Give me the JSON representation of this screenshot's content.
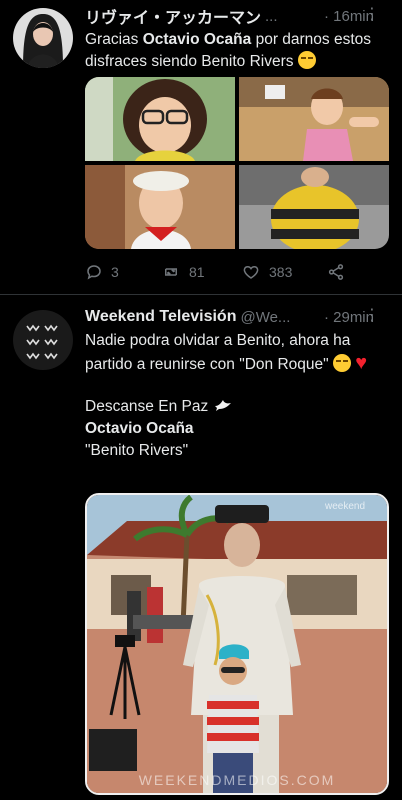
{
  "tweets": [
    {
      "author": "リヴァイ・アッカーマン",
      "handle": "...",
      "time": "· 16min",
      "text_pre": "Gracias ",
      "text_bold": "Octavio Ocaña",
      "text_post": " por darnos estos disfraces siendo Benito Rivers",
      "replies": "3",
      "retweets": "81",
      "likes": "383"
    },
    {
      "author": "Weekend Televisión",
      "handle": "@We...",
      "time": "· 29min",
      "line1": "Nadie podra olvidar a Benito, ahora ha partido a reunirse con \"Don Roque\"",
      "line2": "Descanse En Paz",
      "line3": "Octavio Ocaña",
      "line4": "\"Benito Rivers\"",
      "watermark": "WEEKENDMEDIOS.COM",
      "photo_logo": "weekend"
    }
  ],
  "colors": {
    "background": "#000000",
    "text": "#e7e9ea",
    "muted": "#71767b",
    "divider": "#2f3336",
    "heart": "#f4212e"
  },
  "icons": [
    "reply-icon",
    "retweet-icon",
    "like-icon",
    "share-icon",
    "more-icon",
    "dove-icon"
  ]
}
